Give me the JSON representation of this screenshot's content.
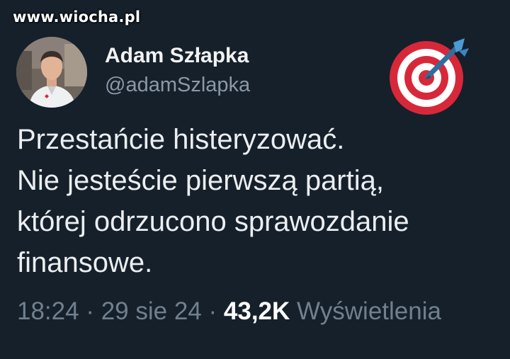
{
  "watermark": "www.wiocha.pl",
  "author": {
    "display_name": "Adam Szłapka",
    "handle": "@adamSzlapka",
    "avatar_icon": "profile-photo",
    "badge_icon": "direct-hit-target-icon"
  },
  "tweet": {
    "lines": [
      "Przestańcie histeryzować.",
      "Nie jesteście pierwszą partią,",
      "której odrzucono sprawozdanie",
      "finansowe."
    ]
  },
  "meta": {
    "time": "18:24",
    "separator": "·",
    "date": "29 sie 24",
    "views_count": "43,2K",
    "views_label": "Wyświetlenia"
  },
  "colors": {
    "background": "#15202b",
    "text": "#e7e9ea",
    "secondary": "#71808e",
    "target_red": "#d7283a"
  }
}
